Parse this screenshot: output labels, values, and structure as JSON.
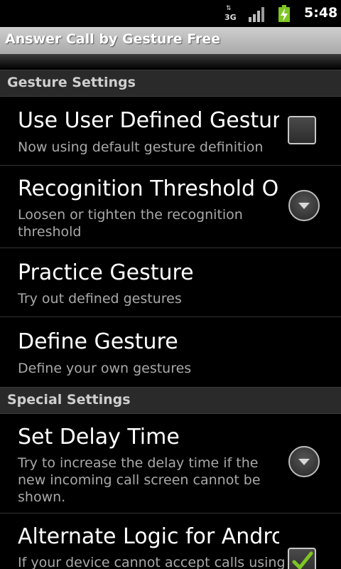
{
  "status_bar": {
    "network": "3G",
    "time": "5:48"
  },
  "title_bar": {
    "title": "Answer Call by Gesture Free"
  },
  "sections": [
    {
      "header": "Gesture Settings",
      "items": [
        {
          "title": "Use User Defined Gestures",
          "summary": "Now using default gesture definition",
          "widget": "checkbox",
          "checked": false
        },
        {
          "title": "Recognition Threshold Offset",
          "summary": "Loosen or tighten the recognition threshold",
          "widget": "dropdown"
        },
        {
          "title": "Practice Gesture",
          "summary": "Try out defined gestures",
          "widget": "none"
        },
        {
          "title": "Define Gesture",
          "summary": "Define your own gestures",
          "widget": "none"
        }
      ]
    },
    {
      "header": "Special Settings",
      "items": [
        {
          "title": "Set Delay Time",
          "summary": "Try to increase the delay time if the new incoming call screen cannot be shown.",
          "widget": "dropdown"
        },
        {
          "title": "Alternate Logic for Android",
          "summary": "If your device cannot accept calls using",
          "widget": "checkbox",
          "checked": true
        }
      ]
    }
  ],
  "colors": {
    "background": "#000000",
    "section_bg": "#2a2a2a",
    "battery": "#7ec623",
    "check": "#7ec623"
  }
}
